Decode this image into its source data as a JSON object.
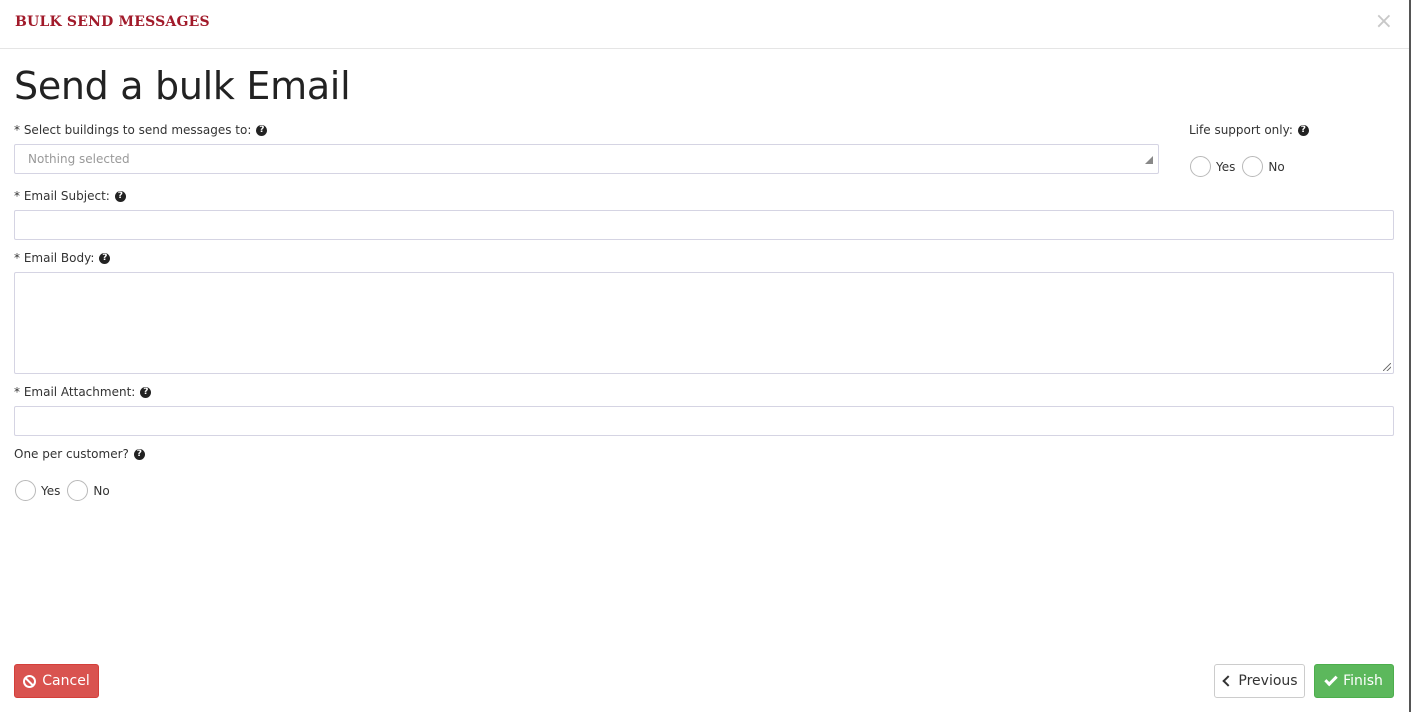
{
  "modal": {
    "title": "BULK SEND MESSAGES",
    "close_icon": "×"
  },
  "page_title": "Send a bulk Email",
  "fields": {
    "buildings": {
      "label": "* Select buildings to send messages to:",
      "placeholder": "Nothing selected",
      "help_icon": "?"
    },
    "life_support": {
      "label": "Life support only:",
      "help_icon": "?",
      "options": [
        "Yes",
        "No"
      ],
      "selected": null
    },
    "subject": {
      "label": "* Email Subject:",
      "value": "",
      "help_icon": "?"
    },
    "body": {
      "label": "* Email Body:",
      "value": "",
      "help_icon": "?"
    },
    "attachment": {
      "label": "* Email Attachment:",
      "value": "",
      "help_icon": "?"
    },
    "one_per_customer": {
      "label": "One per customer?",
      "help_icon": "?",
      "options": [
        "Yes",
        "No"
      ],
      "selected": null
    }
  },
  "footer": {
    "cancel_label": "Cancel",
    "previous_label": "Previous",
    "finish_label": "Finish"
  },
  "colors": {
    "title": "#a11a2a",
    "cancel": "#d9534f",
    "finish": "#5cb85c"
  }
}
